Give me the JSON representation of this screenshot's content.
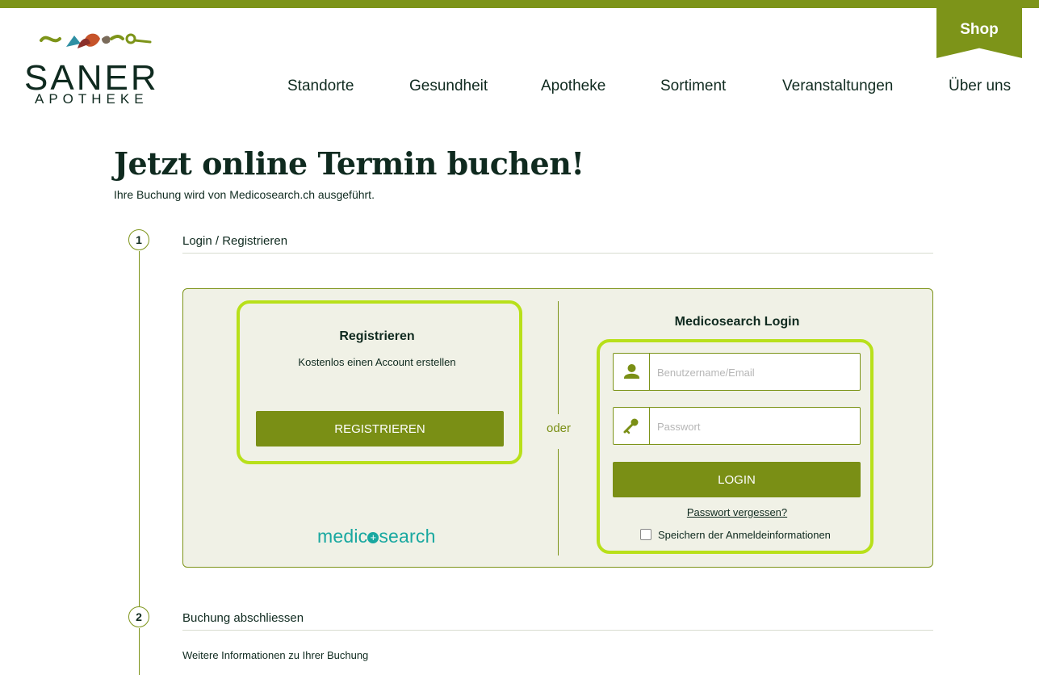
{
  "brand": {
    "name": "SANER",
    "sub": "APOTHEKE",
    "logo_icon": "saner-logo-emblem-icon",
    "colors": {
      "primary": "#7d9419",
      "dark": "#0f2a1f",
      "highlight": "#b8e01a",
      "medico": "#19a8a0",
      "panel_bg": "#f0f1e6"
    }
  },
  "header": {
    "shop_label": "Shop",
    "nav": [
      {
        "label": "Standorte"
      },
      {
        "label": "Gesundheit"
      },
      {
        "label": "Apotheke"
      },
      {
        "label": "Sortiment"
      },
      {
        "label": "Veranstaltungen"
      },
      {
        "label": "Über uns"
      }
    ]
  },
  "page": {
    "title": "Jetzt online Termin buchen!",
    "subtitle": "Ihre Buchung wird von Medicosearch.ch ausgeführt."
  },
  "steps": [
    {
      "number": "1",
      "title": "Login / Registrieren"
    },
    {
      "number": "2",
      "title": "Buchung abschliessen",
      "info": "Weitere Informationen zu Ihrer Buchung"
    }
  ],
  "register": {
    "title": "Registrieren",
    "description": "Kostenlos einen Account erstellen",
    "button": "REGISTRIEREN",
    "provider_logo": "medicosearch"
  },
  "separator": "oder",
  "login": {
    "title": "Medicosearch Login",
    "username": {
      "value": "",
      "placeholder": "Benutzername/Email",
      "icon": "user-icon"
    },
    "password": {
      "value": "",
      "placeholder": "Passwort",
      "icon": "key-icon"
    },
    "button": "LOGIN",
    "forgot": "Passwort vergessen?",
    "remember_label": "Speichern der Anmeldeinformationen",
    "remember_checked": false
  }
}
